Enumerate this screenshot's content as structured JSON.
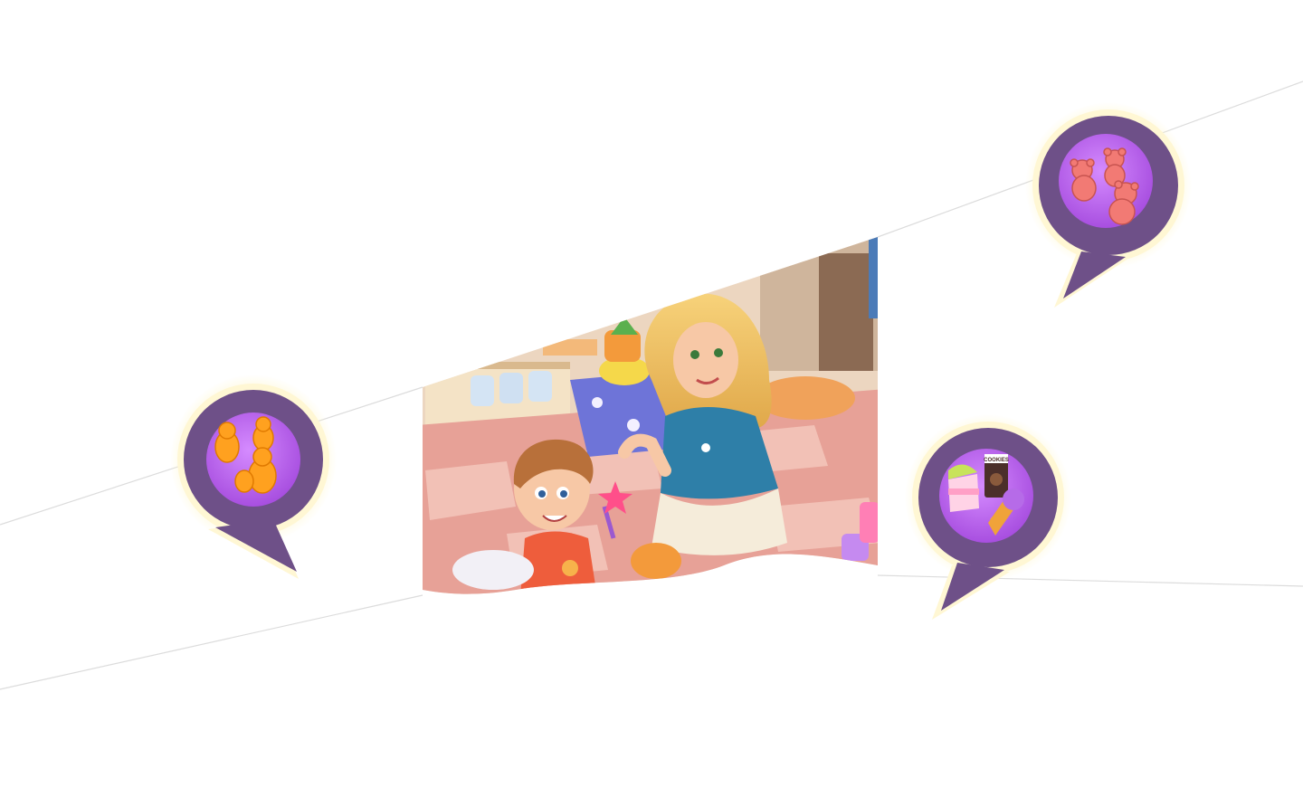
{
  "scene": {
    "theme": "cozy-home-interior",
    "background_color": "#ffffff",
    "line_color": "#d9d9d9",
    "illustration": {
      "subject": "mother-and-child-playroom",
      "floor_color": "#e8a39a",
      "tile_light": "#f2c3b8",
      "wall_color": "#e9d3bd"
    }
  },
  "bubbles": [
    {
      "icon": "gummy-bears-icon",
      "outer_color": "#6e5088",
      "inner_color": "#b45ee8",
      "glow": "#fff3b8"
    },
    {
      "icon": "teddy-bears-icon",
      "outer_color": "#6e5088",
      "inner_color": "#b45ee8",
      "glow": "#fff3b8"
    },
    {
      "icon": "snacks-icon",
      "outer_color": "#6e5088",
      "inner_color": "#b45ee8",
      "glow": "#fff3b8"
    }
  ],
  "snack_packet_label": "COOKIES"
}
